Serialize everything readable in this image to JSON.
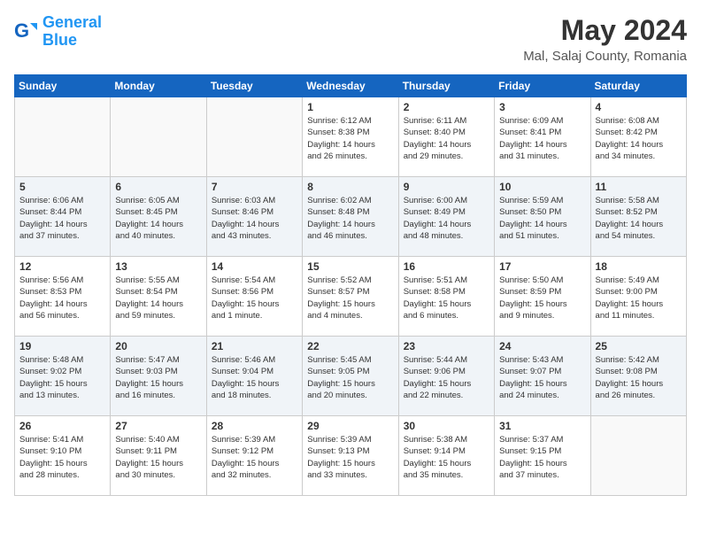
{
  "header": {
    "logo_line1": "General",
    "logo_line2": "Blue",
    "month_year": "May 2024",
    "location": "Mal, Salaj County, Romania"
  },
  "days_of_week": [
    "Sunday",
    "Monday",
    "Tuesday",
    "Wednesday",
    "Thursday",
    "Friday",
    "Saturday"
  ],
  "weeks": [
    [
      {
        "day": "",
        "content": ""
      },
      {
        "day": "",
        "content": ""
      },
      {
        "day": "",
        "content": ""
      },
      {
        "day": "1",
        "content": "Sunrise: 6:12 AM\nSunset: 8:38 PM\nDaylight: 14 hours\nand 26 minutes."
      },
      {
        "day": "2",
        "content": "Sunrise: 6:11 AM\nSunset: 8:40 PM\nDaylight: 14 hours\nand 29 minutes."
      },
      {
        "day": "3",
        "content": "Sunrise: 6:09 AM\nSunset: 8:41 PM\nDaylight: 14 hours\nand 31 minutes."
      },
      {
        "day": "4",
        "content": "Sunrise: 6:08 AM\nSunset: 8:42 PM\nDaylight: 14 hours\nand 34 minutes."
      }
    ],
    [
      {
        "day": "5",
        "content": "Sunrise: 6:06 AM\nSunset: 8:44 PM\nDaylight: 14 hours\nand 37 minutes."
      },
      {
        "day": "6",
        "content": "Sunrise: 6:05 AM\nSunset: 8:45 PM\nDaylight: 14 hours\nand 40 minutes."
      },
      {
        "day": "7",
        "content": "Sunrise: 6:03 AM\nSunset: 8:46 PM\nDaylight: 14 hours\nand 43 minutes."
      },
      {
        "day": "8",
        "content": "Sunrise: 6:02 AM\nSunset: 8:48 PM\nDaylight: 14 hours\nand 46 minutes."
      },
      {
        "day": "9",
        "content": "Sunrise: 6:00 AM\nSunset: 8:49 PM\nDaylight: 14 hours\nand 48 minutes."
      },
      {
        "day": "10",
        "content": "Sunrise: 5:59 AM\nSunset: 8:50 PM\nDaylight: 14 hours\nand 51 minutes."
      },
      {
        "day": "11",
        "content": "Sunrise: 5:58 AM\nSunset: 8:52 PM\nDaylight: 14 hours\nand 54 minutes."
      }
    ],
    [
      {
        "day": "12",
        "content": "Sunrise: 5:56 AM\nSunset: 8:53 PM\nDaylight: 14 hours\nand 56 minutes."
      },
      {
        "day": "13",
        "content": "Sunrise: 5:55 AM\nSunset: 8:54 PM\nDaylight: 14 hours\nand 59 minutes."
      },
      {
        "day": "14",
        "content": "Sunrise: 5:54 AM\nSunset: 8:56 PM\nDaylight: 15 hours\nand 1 minute."
      },
      {
        "day": "15",
        "content": "Sunrise: 5:52 AM\nSunset: 8:57 PM\nDaylight: 15 hours\nand 4 minutes."
      },
      {
        "day": "16",
        "content": "Sunrise: 5:51 AM\nSunset: 8:58 PM\nDaylight: 15 hours\nand 6 minutes."
      },
      {
        "day": "17",
        "content": "Sunrise: 5:50 AM\nSunset: 8:59 PM\nDaylight: 15 hours\nand 9 minutes."
      },
      {
        "day": "18",
        "content": "Sunrise: 5:49 AM\nSunset: 9:00 PM\nDaylight: 15 hours\nand 11 minutes."
      }
    ],
    [
      {
        "day": "19",
        "content": "Sunrise: 5:48 AM\nSunset: 9:02 PM\nDaylight: 15 hours\nand 13 minutes."
      },
      {
        "day": "20",
        "content": "Sunrise: 5:47 AM\nSunset: 9:03 PM\nDaylight: 15 hours\nand 16 minutes."
      },
      {
        "day": "21",
        "content": "Sunrise: 5:46 AM\nSunset: 9:04 PM\nDaylight: 15 hours\nand 18 minutes."
      },
      {
        "day": "22",
        "content": "Sunrise: 5:45 AM\nSunset: 9:05 PM\nDaylight: 15 hours\nand 20 minutes."
      },
      {
        "day": "23",
        "content": "Sunrise: 5:44 AM\nSunset: 9:06 PM\nDaylight: 15 hours\nand 22 minutes."
      },
      {
        "day": "24",
        "content": "Sunrise: 5:43 AM\nSunset: 9:07 PM\nDaylight: 15 hours\nand 24 minutes."
      },
      {
        "day": "25",
        "content": "Sunrise: 5:42 AM\nSunset: 9:08 PM\nDaylight: 15 hours\nand 26 minutes."
      }
    ],
    [
      {
        "day": "26",
        "content": "Sunrise: 5:41 AM\nSunset: 9:10 PM\nDaylight: 15 hours\nand 28 minutes."
      },
      {
        "day": "27",
        "content": "Sunrise: 5:40 AM\nSunset: 9:11 PM\nDaylight: 15 hours\nand 30 minutes."
      },
      {
        "day": "28",
        "content": "Sunrise: 5:39 AM\nSunset: 9:12 PM\nDaylight: 15 hours\nand 32 minutes."
      },
      {
        "day": "29",
        "content": "Sunrise: 5:39 AM\nSunset: 9:13 PM\nDaylight: 15 hours\nand 33 minutes."
      },
      {
        "day": "30",
        "content": "Sunrise: 5:38 AM\nSunset: 9:14 PM\nDaylight: 15 hours\nand 35 minutes."
      },
      {
        "day": "31",
        "content": "Sunrise: 5:37 AM\nSunset: 9:15 PM\nDaylight: 15 hours\nand 37 minutes."
      },
      {
        "day": "",
        "content": ""
      }
    ]
  ]
}
